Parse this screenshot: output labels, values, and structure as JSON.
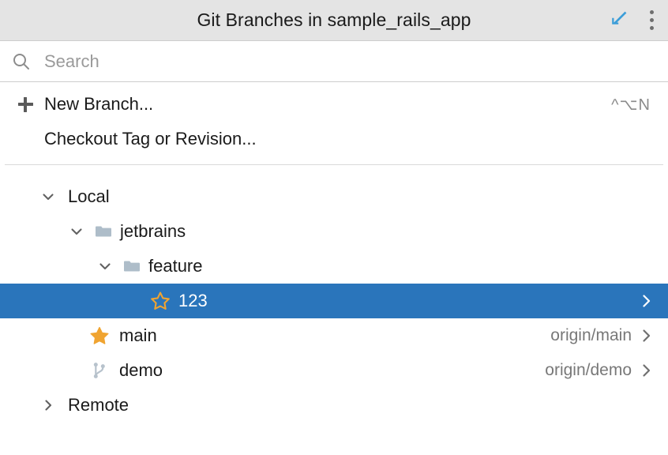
{
  "window": {
    "title": "Git Branches in sample_rails_app",
    "titlebar_actions": [
      {
        "name": "show-as-tool-window-icon",
        "kind": "arrow-down-left",
        "color": "#3b9dd8"
      },
      {
        "name": "more-options-icon",
        "kind": "kebab",
        "color": "#6e6e6e"
      }
    ]
  },
  "search": {
    "placeholder": "Search",
    "value": "",
    "icon": "search-icon"
  },
  "actions": [
    {
      "label": "New Branch...",
      "icon": "plus-icon",
      "shortcut": "^⌥N"
    },
    {
      "label": "Checkout Tag or Revision...",
      "icon": "none",
      "shortcut": ""
    }
  ],
  "tree": [
    {
      "label": "Local",
      "type": "group",
      "indent": 0,
      "twisty": "expanded",
      "icon": "none",
      "tracking": "",
      "chevron": false,
      "selected": false
    },
    {
      "label": "jetbrains",
      "type": "folder",
      "indent": 1,
      "twisty": "expanded",
      "icon": "folder-icon",
      "tracking": "",
      "chevron": false,
      "selected": false
    },
    {
      "label": "feature",
      "type": "folder",
      "indent": 2,
      "twisty": "expanded",
      "icon": "folder-icon",
      "tracking": "",
      "chevron": false,
      "selected": false
    },
    {
      "label": "123",
      "type": "branch",
      "indent": 3,
      "twisty": "none",
      "icon": "star-outline-icon",
      "tracking": "",
      "chevron": true,
      "selected": true
    },
    {
      "label": "main",
      "type": "branch",
      "indent": 1,
      "twisty": "none",
      "icon": "star-filled-icon",
      "tracking": "origin/main",
      "chevron": true,
      "selected": false
    },
    {
      "label": "demo",
      "type": "branch",
      "indent": 1,
      "twisty": "none",
      "icon": "git-branch-icon",
      "tracking": "origin/demo",
      "chevron": true,
      "selected": false
    },
    {
      "label": "Remote",
      "type": "group",
      "indent": 0,
      "twisty": "collapsed",
      "icon": "none",
      "tracking": "",
      "chevron": false,
      "selected": false
    }
  ],
  "colors": {
    "selection": "#2a75bb",
    "star": "#f0a431",
    "folder": "#aebdc9",
    "branch_icon": "#b7c2cc",
    "titlebar_bg": "#e4e4e4",
    "accent_icon": "#3b9dd8"
  }
}
